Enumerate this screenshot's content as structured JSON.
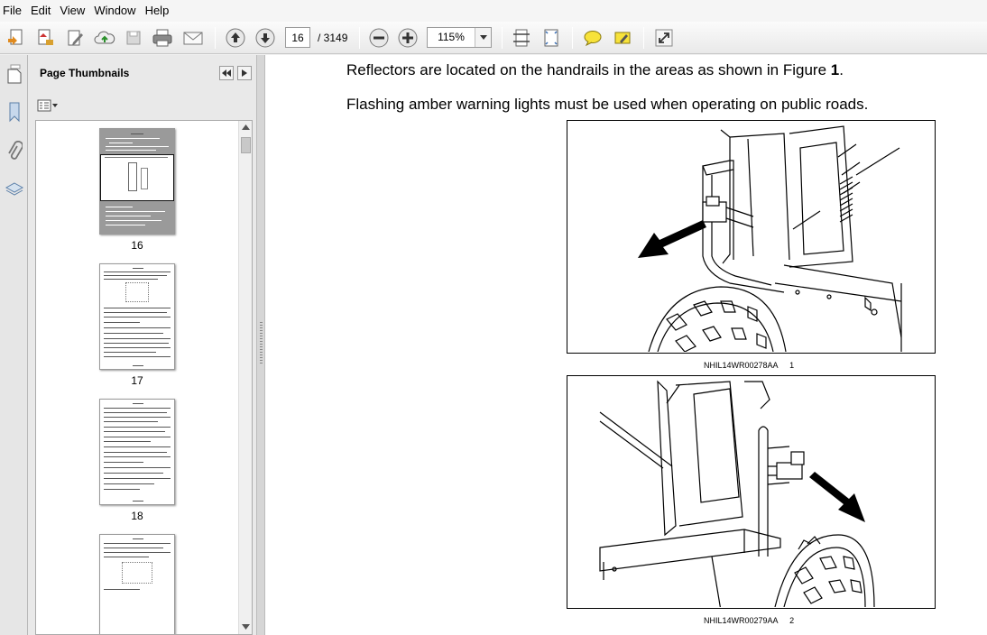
{
  "menu": [
    "File",
    "Edit",
    "View",
    "Window",
    "Help"
  ],
  "toolbar": {
    "page_current": "16",
    "page_total": "/ 3149",
    "zoom": "115%"
  },
  "thumbnails": {
    "title": "Page Thumbnails",
    "pages": [
      {
        "label": "16",
        "selected": true
      },
      {
        "label": "17",
        "selected": false
      },
      {
        "label": "18",
        "selected": false
      },
      {
        "label": ""
      }
    ]
  },
  "document": {
    "line1_prefix": "Reflectors are located on the handrails in the areas as shown in Figure ",
    "line1_bold": "1",
    "line1_suffix": ".",
    "line2": "Flashing amber warning lights must be used when operating on public roads.",
    "figure1": {
      "code": "NHIL14WR00278AA",
      "number": "1"
    },
    "figure2": {
      "code": "NHIL14WR00279AA",
      "number": "2"
    }
  }
}
